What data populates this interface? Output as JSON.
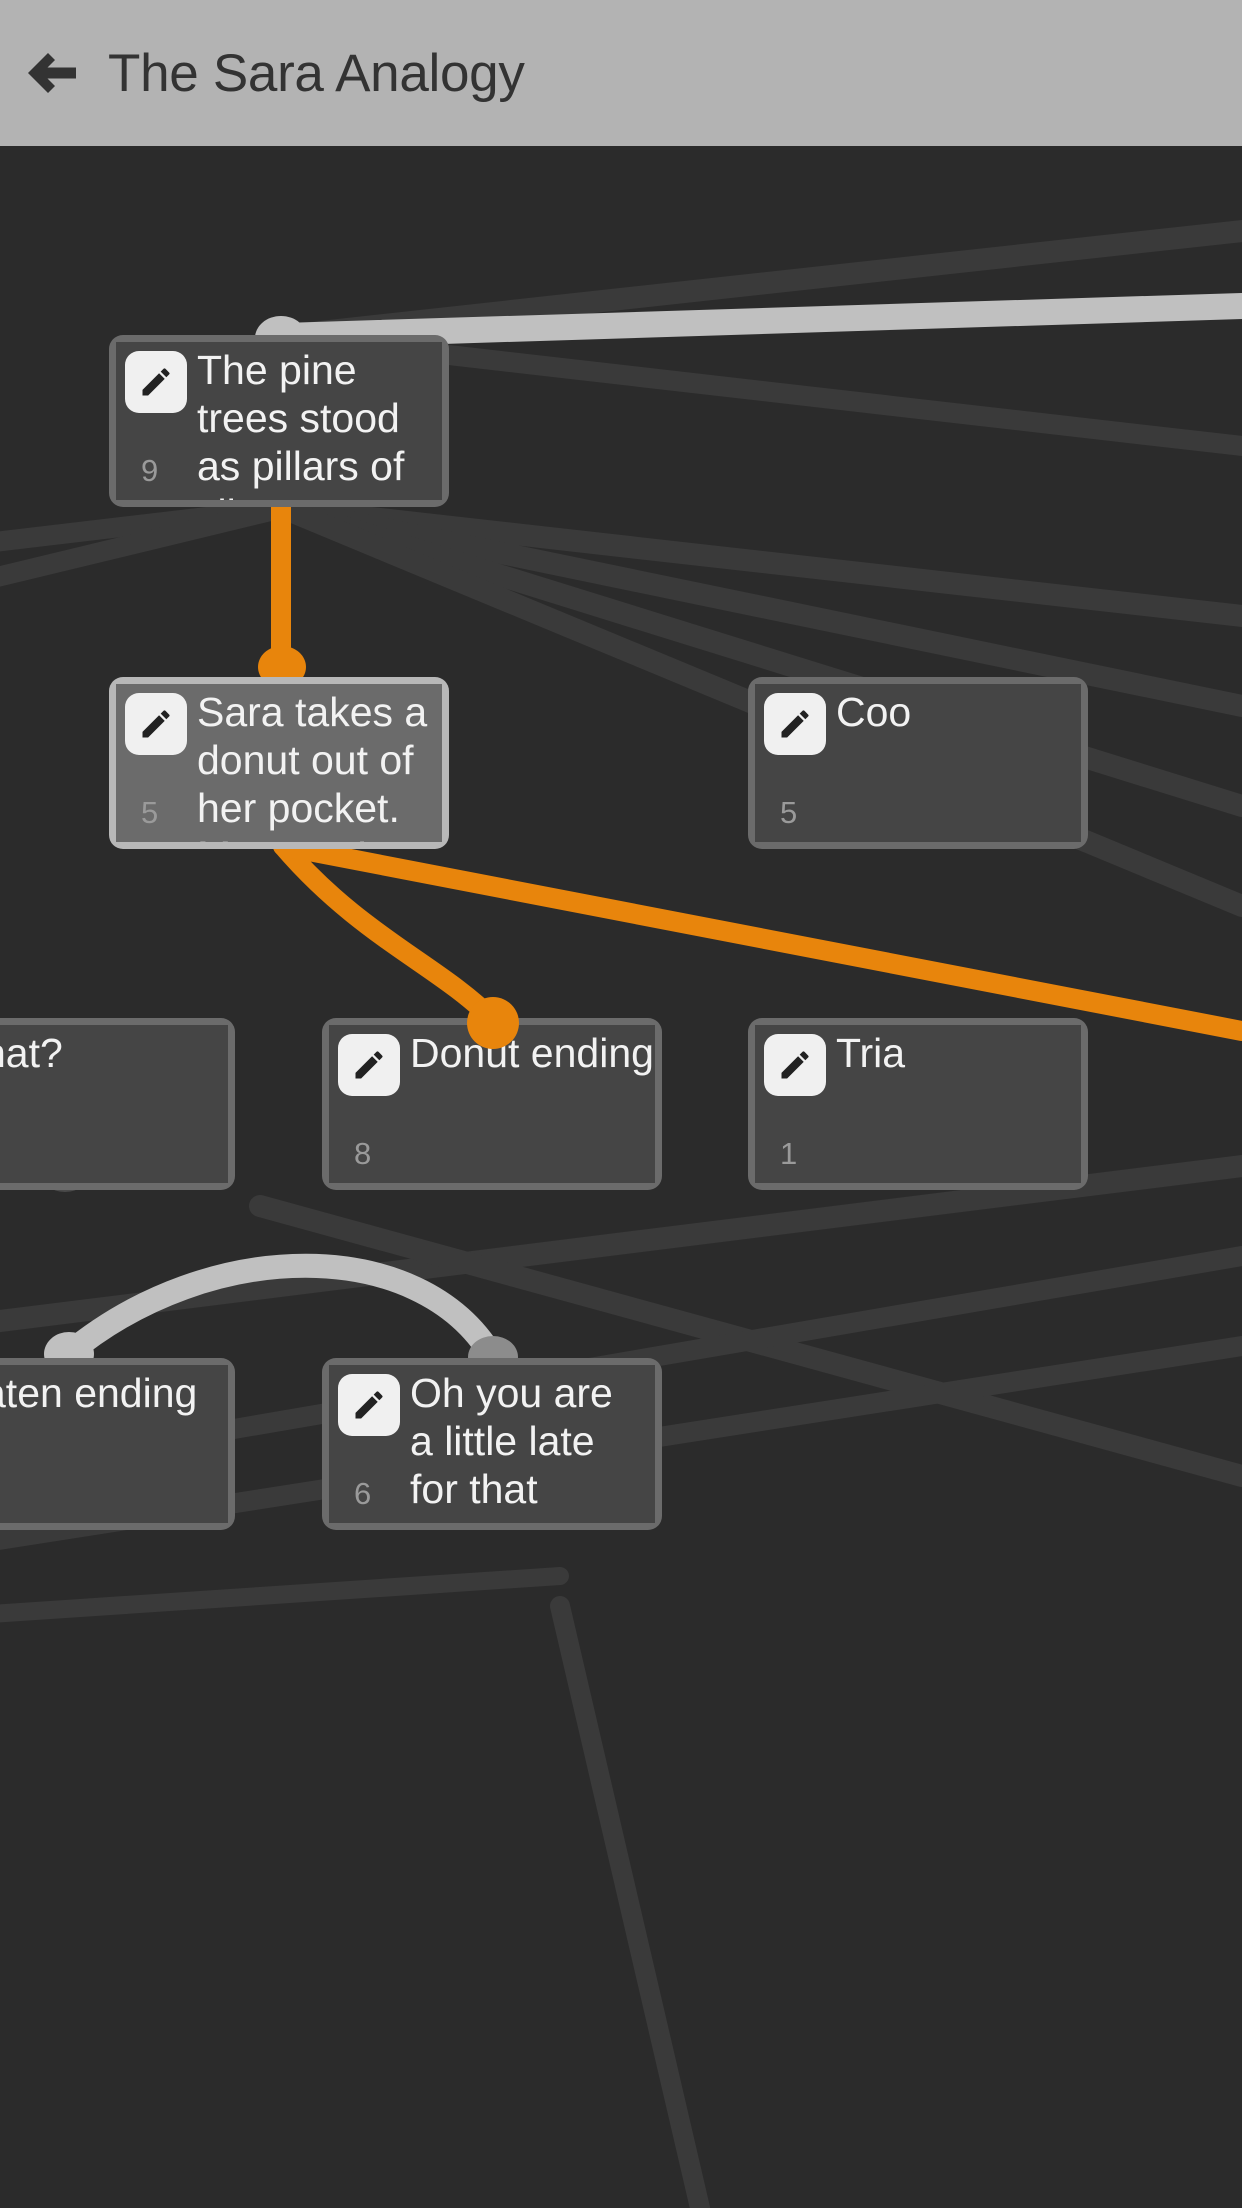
{
  "header": {
    "back_icon": "arrow-left-icon",
    "title": "The Sara Analogy",
    "bg_color": "#b3b3b3",
    "text_color": "#333333"
  },
  "canvas": {
    "bg_color": "#2b2b2b",
    "edge_color_dim": "#3a3a3a",
    "edge_color_light": "#c0c0c0",
    "edge_color_active": "#e8850c"
  },
  "nodes": [
    {
      "id": "pine-trees",
      "name": "node-pine-trees",
      "text": "The pine trees stood as pillars of silence. They h",
      "count": "9",
      "state": "normal",
      "icon": "pencil-icon"
    },
    {
      "id": "sara-donut",
      "name": "node-sara-donut",
      "text": "Sara takes a donut out of her pocket. Mmmm. It sur",
      "count": "5",
      "state": "active",
      "icon": "pencil-icon"
    },
    {
      "id": "cool",
      "name": "node-cool",
      "text": "Coo",
      "count": "5",
      "state": "normal",
      "icon": "pencil-icon"
    },
    {
      "id": "what",
      "name": "node-what",
      "text": "hat?",
      "count": "",
      "state": "normal",
      "icon": "pencil-icon"
    },
    {
      "id": "donut-ending",
      "name": "node-donut-ending",
      "text": "Donut ending",
      "count": "8",
      "state": "normal",
      "icon": "pencil-icon"
    },
    {
      "id": "triathlon",
      "name": "node-triathlon",
      "text": "Tria",
      "count": "1",
      "state": "normal",
      "icon": "pencil-icon"
    },
    {
      "id": "eaten-ending",
      "name": "node-eaten-ending",
      "text": "aten ending",
      "count": "",
      "state": "normal",
      "icon": "pencil-icon"
    },
    {
      "id": "oh-you-are-late",
      "name": "node-oh-you-are-late",
      "text": "Oh you are a little late for that",
      "count": "6",
      "state": "normal",
      "icon": "pencil-icon"
    }
  ]
}
